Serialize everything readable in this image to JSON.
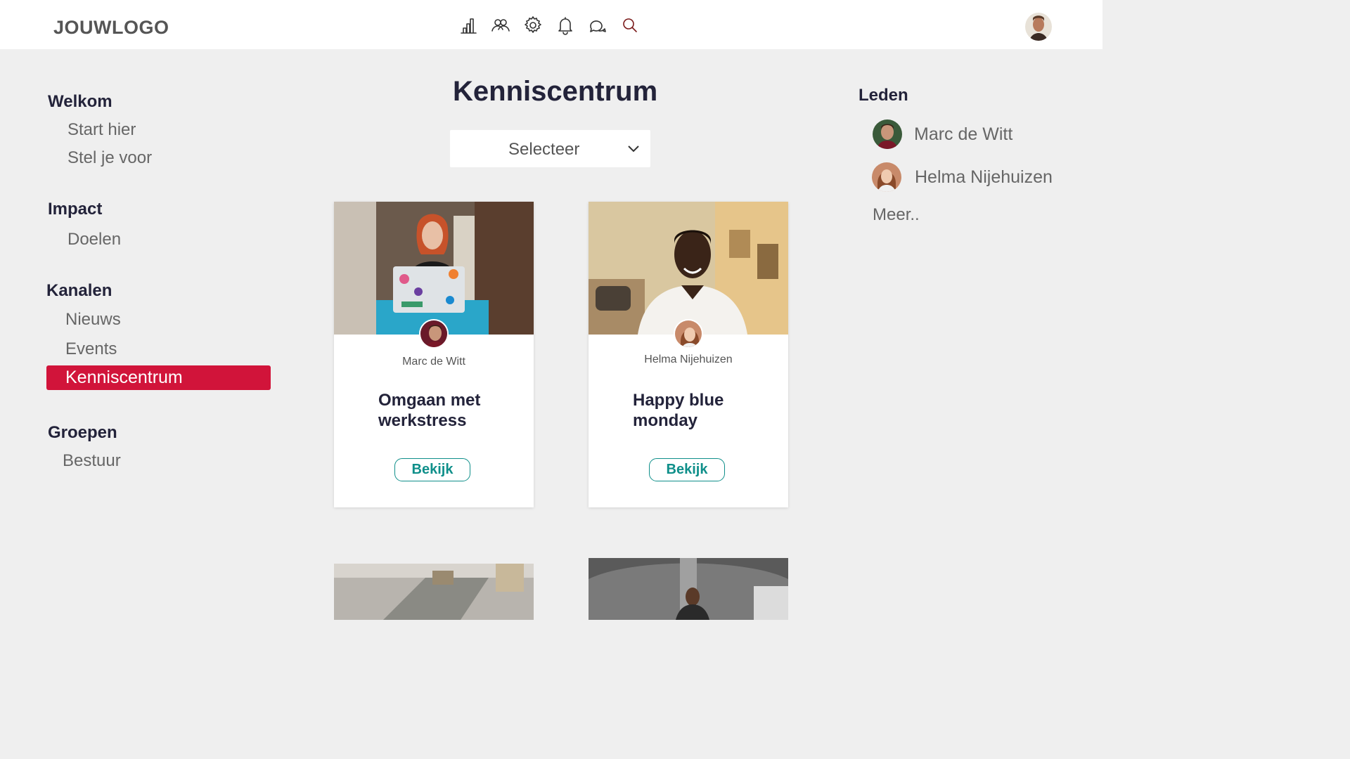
{
  "header": {
    "logo": "JOUWLOGO",
    "icons": [
      "chart-icon",
      "people-icon",
      "gear-icon",
      "bell-icon",
      "chat-icon",
      "search-icon"
    ]
  },
  "sidebar": {
    "sections": [
      {
        "title": "Welkom",
        "items": [
          "Start hier",
          "Stel je voor"
        ]
      },
      {
        "title": "Impact",
        "items": [
          "Doelen"
        ]
      },
      {
        "title": "Kanalen",
        "items": [
          "Nieuws",
          "Events",
          "Kenniscentrum"
        ]
      },
      {
        "title": "Groepen",
        "items": [
          "Bestuur"
        ]
      }
    ],
    "active": "Kenniscentrum"
  },
  "main": {
    "title": "Kenniscentrum",
    "select": {
      "label": "Selecteer"
    },
    "cards": [
      {
        "author": "Marc de Witt",
        "title_line1": "Omgaan met",
        "title_line2": "werkstress",
        "button": "Bekijk"
      },
      {
        "author": "Helma Nijehuizen",
        "title_line1": "Happy blue",
        "title_line2": "monday",
        "button": "Bekijk"
      }
    ]
  },
  "members": {
    "title": "Leden",
    "list": [
      {
        "name": "Marc de Witt"
      },
      {
        "name": "Helma Nijehuizen"
      }
    ],
    "more": "Meer.."
  },
  "colors": {
    "accent": "#d1143a",
    "teal": "#0f8f8a",
    "background": "#efefef",
    "heading": "#23233a"
  }
}
